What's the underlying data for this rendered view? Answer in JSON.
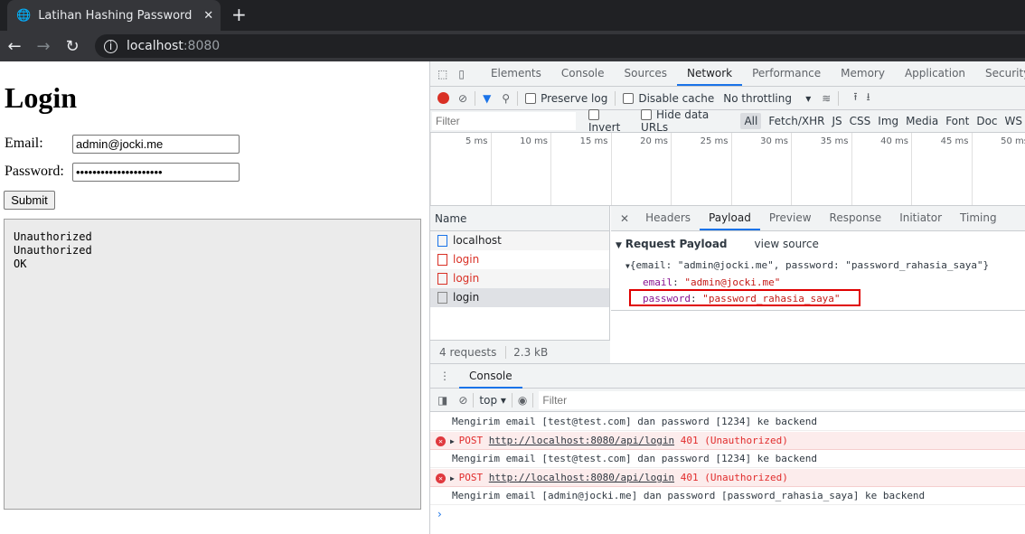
{
  "browser": {
    "tab_title": "Latihan Hashing Password",
    "url_host": "localhost",
    "url_port": ":8080"
  },
  "page": {
    "heading": "Login",
    "email_label": "Email:",
    "email_value": "admin@jocki.me",
    "password_label": "Password:",
    "password_value": "password_rahasia_saya",
    "submit_label": "Submit",
    "output": "Unauthorized\nUnauthorized\nOK"
  },
  "devtools": {
    "tabs": [
      "Elements",
      "Console",
      "Sources",
      "Network",
      "Performance",
      "Memory",
      "Application",
      "Security"
    ],
    "active_tab": "Network",
    "toolbar": {
      "preserve_log": "Preserve log",
      "disable_cache": "Disable cache",
      "throttling": "No throttling"
    },
    "filter": {
      "placeholder": "Filter",
      "invert": "Invert",
      "hide_data_urls": "Hide data URLs",
      "types": [
        "All",
        "Fetch/XHR",
        "JS",
        "CSS",
        "Img",
        "Media",
        "Font",
        "Doc",
        "WS"
      ]
    },
    "timeline_ticks": [
      "5 ms",
      "10 ms",
      "15 ms",
      "20 ms",
      "25 ms",
      "30 ms",
      "35 ms",
      "40 ms",
      "45 ms",
      "50 ms"
    ],
    "name_header": "Name",
    "requests": [
      {
        "name": "localhost",
        "status": "ok"
      },
      {
        "name": "login",
        "status": "error"
      },
      {
        "name": "login",
        "status": "error"
      },
      {
        "name": "login",
        "status": "selected"
      }
    ],
    "summary": {
      "requests": "4 requests",
      "transferred": "2.3 kB transferred"
    },
    "detail_tabs": [
      "Headers",
      "Payload",
      "Preview",
      "Response",
      "Initiator",
      "Timing"
    ],
    "active_detail_tab": "Payload",
    "payload": {
      "title": "Request Payload",
      "view_source": "view source",
      "summary": "{email: \"admin@jocki.me\", password: \"password_rahasia_saya\"}",
      "email_key": "email",
      "email_val": "\"admin@jocki.me\"",
      "password_key": "password",
      "password_val": "\"password_rahasia_saya\""
    },
    "console": {
      "tab": "Console",
      "context": "top",
      "filter_placeholder": "Filter",
      "logs": [
        {
          "type": "log",
          "text": "Mengirim email [test@test.com] dan password [1234] ke backend"
        },
        {
          "type": "error",
          "method": "POST",
          "url": "http://localhost:8080/api/login",
          "status": "401 (Unauthorized)"
        },
        {
          "type": "log",
          "text": "Mengirim email [test@test.com] dan password [1234] ke backend"
        },
        {
          "type": "error",
          "method": "POST",
          "url": "http://localhost:8080/api/login",
          "status": "401 (Unauthorized)"
        },
        {
          "type": "log",
          "text": "Mengirim email [admin@jocki.me] dan password [password_rahasia_saya] ke backend"
        }
      ]
    },
    "colors": {
      "accent": "#1a73e8",
      "error": "#e12c2c",
      "highlight_box": "#e00000"
    }
  }
}
